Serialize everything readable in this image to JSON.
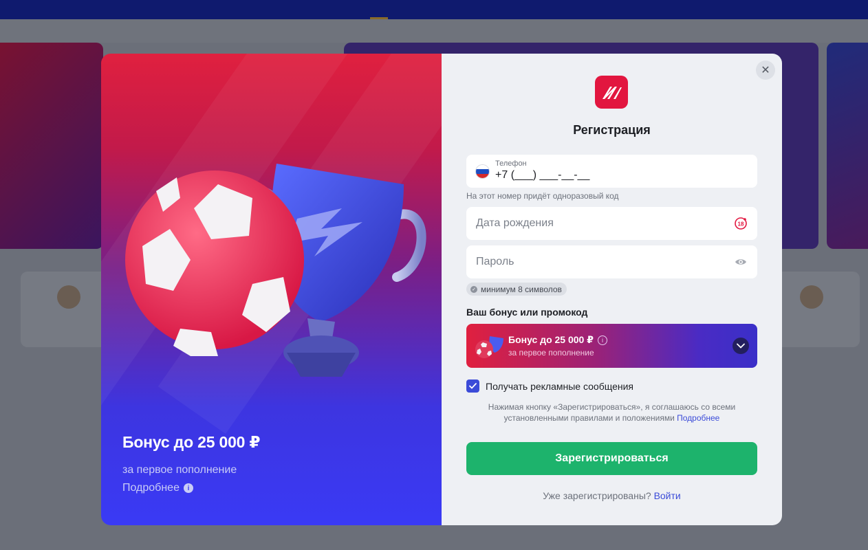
{
  "promo": {
    "title": "Бонус до 25 000 ₽",
    "subtitle": "за первое пополнение",
    "more_label": "Подробнее",
    "info_glyph": "i"
  },
  "form": {
    "close_glyph": "✕",
    "title": "Регистрация",
    "phone": {
      "label": "Телефон",
      "value": "+7 (___) ___-__-__",
      "hint": "На этот номер придёт одноразовый код"
    },
    "birthdate": {
      "placeholder": "Дата рождения",
      "icon": "age-18-plus-icon"
    },
    "password": {
      "placeholder": "Пароль",
      "icon": "eye-icon",
      "rule": "минимум 8 символов"
    },
    "bonus_heading": "Ваш бонус или промокод",
    "bonus": {
      "title": "Бонус до 25 000 ₽",
      "subtitle": "за первое пополнение"
    },
    "consent": {
      "label": "Получать рекламные сообщения",
      "checked": true
    },
    "legal_text": "Нажимая кнопку «Зарегистрироваться», я соглашаюсь со всеми установленными правилами и положениями",
    "legal_link": "Подробнее",
    "submit_label": "Зарегистрироваться",
    "login_prompt": "Уже зарегистрированы?",
    "login_link": "Войти"
  },
  "colors": {
    "brand_red": "#e2163f",
    "accent_blue": "#3b4bd8",
    "submit_green": "#1db36c"
  }
}
